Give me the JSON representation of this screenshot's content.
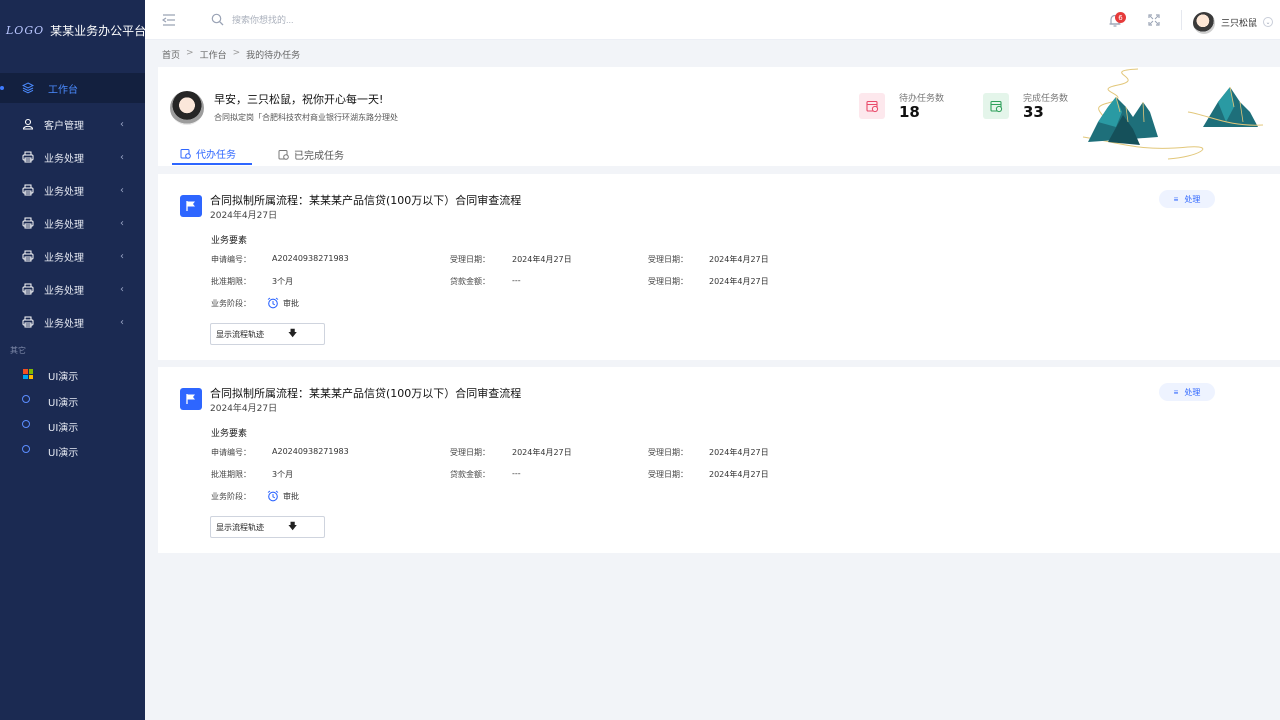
{
  "brand": {
    "logo": "LOGO",
    "name": "某某业务办公平台"
  },
  "sidebar": {
    "items": [
      {
        "label": "工作台",
        "icon": "layers-icon"
      },
      {
        "label": "客户管理",
        "icon": "user-icon"
      },
      {
        "label": "业务处理",
        "icon": "printer-icon"
      },
      {
        "label": "业务处理",
        "icon": "printer-icon"
      },
      {
        "label": "业务处理",
        "icon": "printer-icon"
      },
      {
        "label": "业务处理",
        "icon": "printer-icon"
      },
      {
        "label": "业务处理",
        "icon": "printer-icon"
      },
      {
        "label": "业务处理",
        "icon": "printer-icon"
      }
    ],
    "section_title": "其它",
    "demos": [
      {
        "label": "UI演示",
        "icon": "windows-icon"
      },
      {
        "label": "UI演示",
        "icon": "circle-icon"
      },
      {
        "label": "UI演示",
        "icon": "circle-icon"
      },
      {
        "label": "UI演示",
        "icon": "circle-icon"
      }
    ]
  },
  "topbar": {
    "search_placeholder": "搜索你想找的...",
    "notification_count": "6",
    "username": "三只松鼠"
  },
  "breadcrumb": [
    "首页",
    "工作台",
    "我的待办任务"
  ],
  "breadcrumb_sep": ">",
  "header": {
    "greeting": "早安，三只松鼠，祝你开心每一天!",
    "department": "合同拟定岗「合肥科技农村商业银行环湖东路分理处",
    "tabs": [
      "代办任务",
      "已完成任务"
    ],
    "stats": [
      {
        "label": "待办任务数",
        "value": "18",
        "color": "#e94a6a"
      },
      {
        "label": "完成任务数",
        "value": "33",
        "color": "#2ea05a"
      }
    ]
  },
  "tasks": [
    {
      "title": "合同拟制所属流程：某某某产品信贷(100万以下）合同审查流程",
      "date": "2024年4月27日",
      "action": "处理",
      "section": "业务要素",
      "fields": {
        "app_no_label": "申请编号：",
        "app_no": "A20240938271983",
        "accept_date_label": "受理日期：",
        "accept_date": "2024年4月27日",
        "accept_date2_label": "受理日期：",
        "accept_date2": "2024年4月27日",
        "term_label": "批准期限：",
        "term": "3个月",
        "amount_label": "贷款金额：",
        "amount": "---",
        "accept_date3_label": "受理日期：",
        "accept_date3": "2024年4月27日",
        "stage_label": "业务阶段：",
        "stage": "审批"
      },
      "trace_label": "显示流程轨迹"
    },
    {
      "title": "合同拟制所属流程：某某某产品信贷(100万以下）合同审查流程",
      "date": "2024年4月27日",
      "action": "处理",
      "section": "业务要素",
      "fields": {
        "app_no_label": "申请编号：",
        "app_no": "A20240938271983",
        "accept_date_label": "受理日期：",
        "accept_date": "2024年4月27日",
        "accept_date2_label": "受理日期：",
        "accept_date2": "2024年4月27日",
        "term_label": "批准期限：",
        "term": "3个月",
        "amount_label": "贷款金额：",
        "amount": "---",
        "accept_date3_label": "受理日期：",
        "accept_date3": "2024年4月27日",
        "stage_label": "业务阶段：",
        "stage": "审批"
      },
      "trace_label": "显示流程轨迹"
    }
  ]
}
